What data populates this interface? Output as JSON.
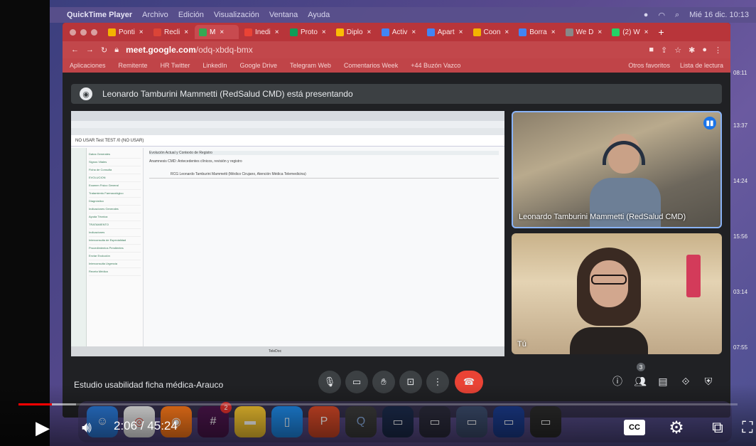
{
  "menubar": {
    "app_name": "QuickTime Player",
    "menus": [
      "Archivo",
      "Edición",
      "Visualización",
      "Ventana",
      "Ayuda"
    ],
    "clock": "Mié 16 dic. 10:13"
  },
  "browser": {
    "tabs": [
      {
        "label": "Ponti",
        "active": false,
        "color": "#f4b400"
      },
      {
        "label": "Recli",
        "active": false,
        "color": "#db4437"
      },
      {
        "label": "M",
        "active": true,
        "color": "#34a853"
      },
      {
        "label": "Inedi",
        "active": false,
        "color": "#ea4335"
      },
      {
        "label": "Proto",
        "active": false,
        "color": "#0f9d58"
      },
      {
        "label": "Diplo",
        "active": false,
        "color": "#fbbc05"
      },
      {
        "label": "Activ",
        "active": false,
        "color": "#4285f4"
      },
      {
        "label": "Apart",
        "active": false,
        "color": "#4285f4"
      },
      {
        "label": "Coon",
        "active": false,
        "color": "#f4b400"
      },
      {
        "label": "Borra",
        "active": false,
        "color": "#4285f4"
      },
      {
        "label": "We D",
        "active": false,
        "color": "#888888"
      },
      {
        "label": "(2) W",
        "active": false,
        "color": "#25d366"
      }
    ],
    "url_host": "meet.google.com",
    "url_path": "/odq-xbdq-bmx",
    "bookmarks": [
      "Aplicaciones",
      "Remitente",
      "HR Twitter",
      "LinkedIn",
      "Google Drive",
      "Telegram Web",
      "Comentarios Week",
      "+44 Buzón Vazco"
    ],
    "bookmarks_right": [
      "Otros favoritos",
      "Lista de lectura"
    ]
  },
  "meet": {
    "presenting_banner": "Leonardo Tamburini Mammetti (RedSalud CMD) está presentando",
    "participant_1_name": "Leonardo Tamburini Mammetti (RedSalud CMD)",
    "participant_2_name": "Tú",
    "meeting_title": "Estudio usabilidad ficha médica-Arauco",
    "participant_count": "3",
    "shared_screen": {
      "header_left": "NO USAR Test TEST /0 (NO USAR)",
      "nav_items": [
        "Datos Generales",
        "Signos Vitales",
        "Ficha de Consulta",
        "EVOLUCION",
        "Examen Físico General",
        "Tratamiento Farmacológico",
        "Diagnóstico",
        "Indicaciones Generales",
        "Ayuda Técnica",
        "TRATAMIENTO",
        "Indicaciones",
        "Interconsulta de Especialidad",
        "Procedimientos Pendientes",
        "Enviar Evolución",
        "Interconsulta Urgencia",
        "Receta Médica"
      ],
      "main_line_1": "Evolución Actual y Contexto de Registro",
      "main_line_2": "Anamnesis CMD: Antecedentes clínicos, revisión y registro",
      "main_line_3": "RCG Leonardo Tamburini Mammetti (Médico Cirujano, Atención Médica Telemedicina)",
      "taskbar_text": "TeleDoc"
    }
  },
  "side_times": [
    "08:11",
    "13:37",
    "14:24",
    "15:56",
    "03:14",
    "07:55"
  ],
  "player": {
    "time_current": "2:06",
    "time_total": "45:24",
    "progress_played": 0.046,
    "progress_loaded": 0.08,
    "cc_label": "CC"
  }
}
